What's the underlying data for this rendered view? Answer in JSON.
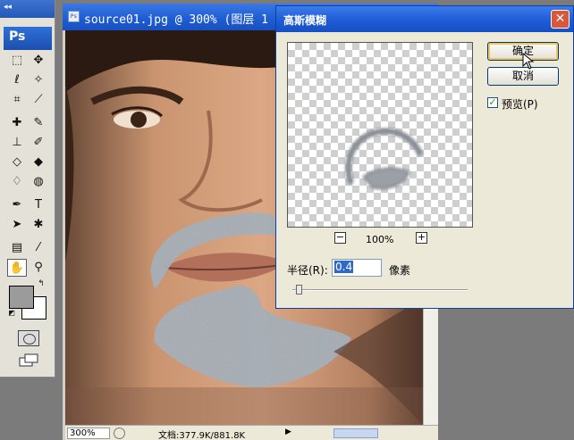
{
  "toolbox": {
    "collapse_label": "◂◂",
    "logo": "Ps"
  },
  "document": {
    "title": "source01.jpg @ 300% (图层 1",
    "zoom": "300%",
    "doc_info": "文档:377.9K/881.8K"
  },
  "dialog": {
    "title": "高斯模糊",
    "close_symbol": "✕",
    "ok_label": "确定",
    "cancel_label": "取消",
    "preview_checkbox_label": "预览(P)",
    "preview_checked": true,
    "zoom_out_symbol": "−",
    "zoom_in_symbol": "+",
    "preview_zoom": "100%",
    "radius_label": "半径(R):",
    "radius_value": "0.4",
    "radius_unit": "像素",
    "radius_slider_fraction": 0.02
  },
  "colors": {
    "xp_title_blue": "#1e5bd6",
    "foreground_swatch": "#9b9b9b",
    "background_swatch": "#ffffff",
    "beard_blue_gray": "#9aa3ad"
  }
}
